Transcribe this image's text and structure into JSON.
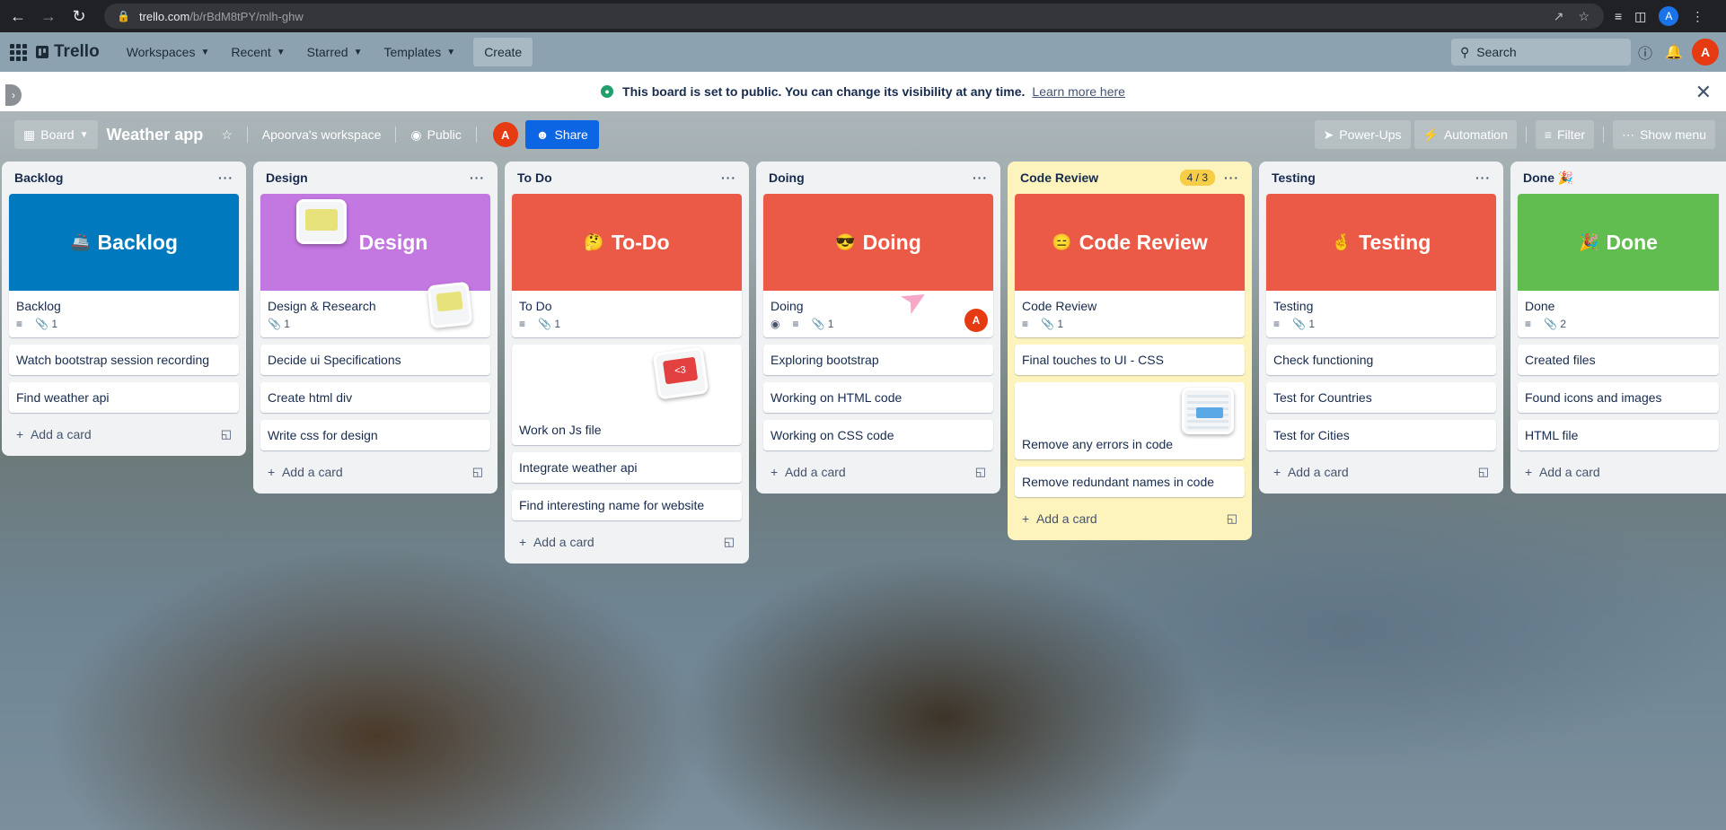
{
  "browser": {
    "url_host": "trello.com",
    "url_path": "/b/rBdM8tPY/mlh-ghw",
    "profile_initial": "A"
  },
  "header": {
    "logo": "Trello",
    "menus": [
      "Workspaces",
      "Recent",
      "Starred",
      "Templates"
    ],
    "create": "Create",
    "search_placeholder": "Search",
    "avatar_initial": "A"
  },
  "banner": {
    "text": "This board is set to public. You can change its visibility at any time.",
    "link": "Learn more here"
  },
  "board": {
    "view": "Board",
    "title": "Weather app",
    "workspace": "Apoorva's workspace",
    "visibility": "Public",
    "member_initial": "A",
    "share": "Share",
    "powerups": "Power-Ups",
    "automation": "Automation",
    "filter": "Filter",
    "show_menu": "Show menu"
  },
  "add_card_label": "Add a card",
  "lists": [
    {
      "title": "Backlog",
      "cover_color": "#0079bf",
      "cover_emoji": "🚢",
      "cover_text": "Backlog",
      "card_title": "Backlog",
      "attachments": "1",
      "cards": [
        "Watch bootstrap session recording",
        "Find weather api"
      ]
    },
    {
      "title": "Design",
      "cover_color": "#c377e0",
      "cover_text": "Design",
      "card_title": "Design & Research",
      "attachments": "1",
      "cards": [
        "Decide ui Specifications",
        "Create html div",
        "Write css for design"
      ]
    },
    {
      "title": "To Do",
      "cover_color": "#eb5a46",
      "cover_emoji": "🤔",
      "cover_text": "To-Do",
      "card_title": "To Do",
      "attachments": "1",
      "image_card": "Work on Js file",
      "image_sticker_text": "<3",
      "cards": [
        "Integrate weather api",
        "Find interesting name for website"
      ]
    },
    {
      "title": "Doing",
      "cover_color": "#eb5a46",
      "cover_emoji": "😎",
      "cover_text": "Doing",
      "card_title": "Doing",
      "attachments": "1",
      "card_avatar": "A",
      "cards": [
        "Exploring bootstrap",
        "Working on HTML code",
        "Working on CSS code"
      ]
    },
    {
      "title": "Code Review",
      "wip": "4 / 3",
      "cover_color": "#eb5a46",
      "cover_emoji": "😑",
      "cover_text": "Code Review",
      "card_title": "Code Review",
      "attachments": "1",
      "first_card": "Final touches to UI - CSS",
      "image_card": "Remove any errors in code",
      "cards": [
        "Remove redundant names in code"
      ]
    },
    {
      "title": "Testing",
      "cover_color": "#eb5a46",
      "cover_emoji": "🤞",
      "cover_text": "Testing",
      "card_title": "Testing",
      "attachments": "1",
      "cards": [
        "Check functioning",
        "Test for Countries",
        "Test for Cities"
      ]
    },
    {
      "title": "Done 🎉",
      "cover_color": "#61bd4f",
      "cover_emoji": "🎉",
      "cover_text": "Done",
      "card_title": "Done",
      "attachments": "2",
      "cards": [
        "Created files",
        "Found icons and images",
        "HTML file"
      ]
    }
  ]
}
